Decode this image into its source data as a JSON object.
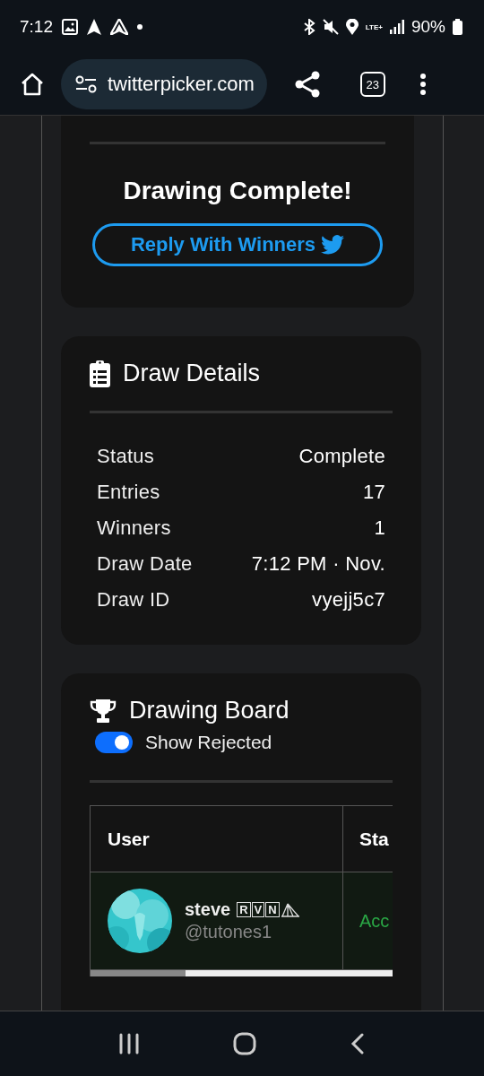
{
  "status_bar": {
    "time": "7:12",
    "network": "LTE+",
    "battery": "90%"
  },
  "browser": {
    "url": "twitterpicker.com",
    "tab_count": "23"
  },
  "result_card": {
    "title": "Drawing Complete!",
    "button": "Reply With Winners"
  },
  "details_card": {
    "title": "Draw Details",
    "rows": [
      {
        "label": "Status",
        "value": "Complete"
      },
      {
        "label": "Entries",
        "value": "17"
      },
      {
        "label": "Winners",
        "value": "1"
      },
      {
        "label": "Draw Date",
        "value": "7:12 PM · Nov."
      },
      {
        "label": "Draw ID",
        "value": "vyejj5c7"
      }
    ]
  },
  "board_card": {
    "title": "Drawing Board",
    "show_rejected": {
      "label": "Show Rejected",
      "on": true
    },
    "table": {
      "columns": [
        "User",
        "Sta"
      ],
      "rows": [
        {
          "name": "steve",
          "name_badges": [
            "R",
            "V",
            "N"
          ],
          "handle": "@tutones1",
          "status": "Acc",
          "kind": "accepted"
        }
      ]
    }
  }
}
